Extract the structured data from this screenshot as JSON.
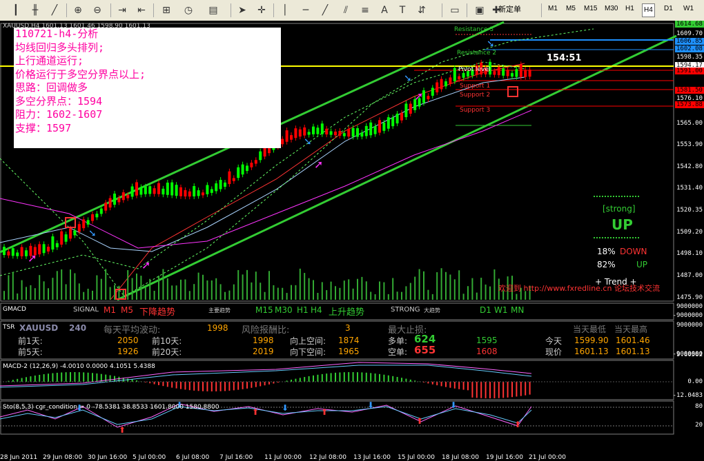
{
  "toolbar": {
    "new_order_label": "新定单",
    "timeframes": [
      "M1",
      "M5",
      "M15",
      "M30",
      "H1",
      "H4",
      "D1",
      "W1"
    ],
    "active_timeframe": "H4"
  },
  "chart": {
    "header": "XAUUSD,H4 1601.13 1601.46 1598.90 1601.13",
    "countdown": "154:51",
    "price_labels": [
      "1614.68",
      "1609.70",
      "1606.85",
      "1602.08",
      "1598.35",
      "1594.17",
      "1591.00",
      "1581.50",
      "1576.10",
      "1573.88",
      "1565.00",
      "1553.90",
      "1542.80",
      "1531.40",
      "1520.35",
      "1509.20",
      "1498.10",
      "1487.00",
      "1475.90"
    ],
    "pivot_labels": {
      "resistance3": "Resistance 3",
      "resistance2": "Resistance 2",
      "pivot": "Pivot level",
      "support1": "Support 1",
      "support2": "Support 2",
      "support3": "Support 3"
    },
    "watermark": "欢迎到 http://www.fxredline.cn 论坛技术交流",
    "signal_panel": {
      "strong": "[strong]",
      "direction": "UP",
      "down_pct": "18%",
      "down_label": "DOWN",
      "up_pct": "82%",
      "up_label": "UP",
      "trend": "+ Trend +"
    }
  },
  "note": {
    "lines": [
      "110721-h4-分析",
      "均线回归多头排列;",
      "上行通道运行;",
      "价格运行于多空分界点以上;",
      "思路：回调做多",
      "多空分界点：1594",
      "阻力：1602-1607",
      "支撑：1597"
    ]
  },
  "gmacd": {
    "label": "GMACD",
    "signal": "SIGNAL",
    "m1": "M1",
    "m5": "M5",
    "down_trend": "下降趋势",
    "main_trend": "主要趋势",
    "m15": "M15",
    "m30": "M30",
    "h1": "H1",
    "h4": "H4",
    "up_trend": "上升趋势",
    "strong": "STRONG",
    "big_trend": "大趋势",
    "d1": "D1",
    "w1": "W1",
    "mn": "MN",
    "scale_top": "9000000",
    "scale_bottom": "-9000000"
  },
  "tsr": {
    "label": "TSR",
    "symbol": "XAUUSD",
    "period": "240",
    "daily_avg_label": "每天平均波动:",
    "daily_avg": "1998",
    "risk_ratio_label": "风险报酬比:",
    "risk_ratio": "3",
    "max_stop_label": "最大止损:",
    "day_low_label": "当天最低",
    "day_high_label": "当天最高",
    "prev1_label": "前1天:",
    "prev1": "2050",
    "prev10_label": "前10天:",
    "prev10": "1998",
    "up_space_label": "向上空间:",
    "up_space": "1874",
    "long_label": "多单:",
    "long_val": "624",
    "long_price": "1595",
    "today_label": "今天",
    "today_low": "1599.90",
    "today_high": "1601.46",
    "prev5_label": "前5天:",
    "prev5": "1926",
    "prev20_label": "前20天:",
    "prev20": "2019",
    "down_space_label": "向下空间:",
    "down_space": "1965",
    "short_label": "空单:",
    "short_val": "655",
    "short_price": "1608",
    "now_label": "现价",
    "now_low": "1601.13",
    "now_high": "1601.13",
    "scale_top": "9000000",
    "scale_bottom": "-9000000"
  },
  "macd": {
    "label": "MACD-2 (12,26,9) -4.0010 0.0000 4.1051 5.4388",
    "scale": [
      "9.60562",
      "0.00",
      "-12.0483"
    ]
  },
  "stoch": {
    "label": "Sto(8,5,3) cgr_condition = 0 -78.5381 38.8533 1601.8000 1580.8800",
    "scale": [
      "80",
      "20"
    ]
  },
  "x_labels": [
    "28 Jun 2011",
    "29 Jun 08:00",
    "30 Jun 16:00",
    "5 Jul 00:00",
    "6 Jul 08:00",
    "7 Jul 16:00",
    "11 Jul 00:00",
    "12 Jul 08:00",
    "13 Jul 16:00",
    "15 Jul 00:00",
    "18 Jul 08:00",
    "19 Jul 16:00",
    "21 Jul 00:00"
  ],
  "colors": {
    "bull": "#00ff00",
    "bear": "#ff0000",
    "channel": "#33cc33",
    "note_text": "#ff00a0",
    "pivot": "#ffff00"
  }
}
